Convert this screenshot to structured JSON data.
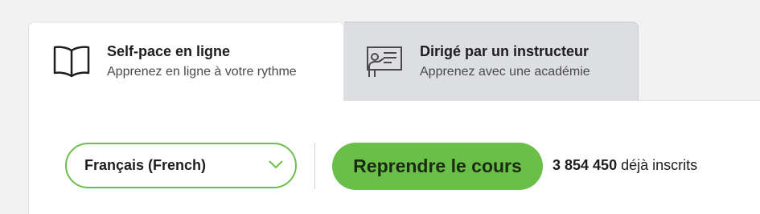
{
  "tabs": [
    {
      "title": "Self-pace en ligne",
      "subtitle": "Apprenez en ligne à votre rythme",
      "icon": "open-book-icon",
      "active": true
    },
    {
      "title": "Dirigé par un instructeur",
      "subtitle": "Apprenez avec une académie",
      "icon": "instructor-whiteboard-icon",
      "active": false
    }
  ],
  "course_actions": {
    "language_select": {
      "value": "Français (French)",
      "icon": "chevron-down-icon"
    },
    "cta_label": "Reprendre le cours",
    "enrolled_count": "3 854 450",
    "enrolled_suffix": "déjà inscrits"
  },
  "colors": {
    "accent_green": "#6abf48",
    "select_border": "#6cc04a",
    "inactive_tab": "#dcdee2",
    "background": "#f2f2f2"
  }
}
